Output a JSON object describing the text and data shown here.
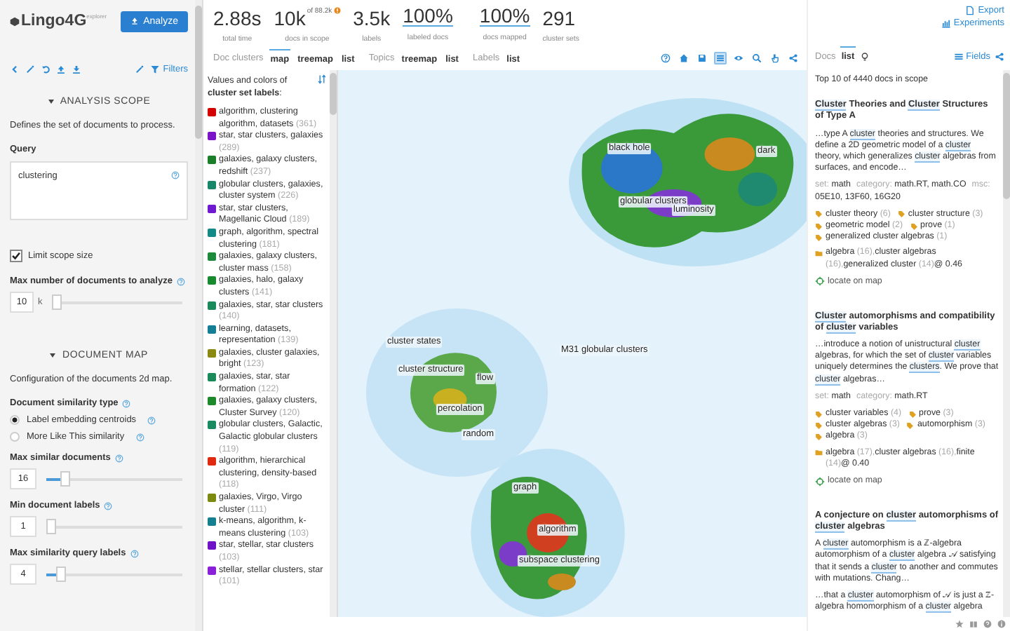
{
  "app": {
    "logo": "Lingo4G",
    "logo_sup": "explorer",
    "analyze_button": "Analyze",
    "filters_link": "Filters"
  },
  "analysis_scope": {
    "title": "ANALYSIS SCOPE",
    "expanded": true,
    "description": "Defines the set of documents to process.",
    "query_label": "Query",
    "query": "clustering",
    "limit_scope": {
      "label": "Limit scope size",
      "checked": true
    },
    "max_docs": {
      "label": "Max number of documents to analyze",
      "value": "10",
      "unit": "k",
      "level": 0.0
    }
  },
  "document_map": {
    "title": "DOCUMENT MAP",
    "expanded": true,
    "description": "Configuration of the documents 2d map.",
    "similarity_label": "Document similarity type",
    "similarity_options": [
      {
        "label": "Label embedding centroids",
        "selected": true
      },
      {
        "label": "More Like This similarity",
        "selected": false
      }
    ],
    "sliders": [
      {
        "label": "Max similar documents",
        "value": "16",
        "level": 0.1
      },
      {
        "label": "Min document labels",
        "value": "1",
        "level": 0.0
      },
      {
        "label": "Max similarity query labels",
        "value": "4",
        "level": 0.07
      }
    ]
  },
  "stats": [
    {
      "value": "2.88s",
      "label": "total time",
      "underlined": false
    },
    {
      "value": "10k",
      "of": "of 88.2k",
      "warning": true,
      "label": "docs in scope",
      "underlined": false
    },
    {
      "value": "3.5k",
      "label": "labels",
      "underlined": false
    },
    {
      "value": "100%",
      "label": "labeled docs",
      "underlined": true
    },
    {
      "value": "100%",
      "label": "docs mapped",
      "underlined": true
    },
    {
      "value": "291",
      "label": "cluster sets",
      "underlined": false
    }
  ],
  "view_tabs": [
    {
      "group": "Doc clusters",
      "tabs": [
        {
          "label": "map",
          "selected": true
        },
        {
          "label": "treemap",
          "selected": false
        },
        {
          "label": "list",
          "selected": false
        }
      ]
    },
    {
      "group": "Topics",
      "tabs": [
        {
          "label": "treemap",
          "selected": false
        },
        {
          "label": "list",
          "selected": false
        }
      ]
    },
    {
      "group": "Labels",
      "tabs": [
        {
          "label": "list",
          "selected": false
        }
      ]
    }
  ],
  "map_tools": [
    {
      "kind": "help",
      "selected": false
    },
    {
      "kind": "home",
      "selected": false
    },
    {
      "kind": "save",
      "selected": false
    },
    {
      "kind": "list",
      "selected": true
    },
    {
      "kind": "eye",
      "selected": false
    },
    {
      "kind": "search",
      "selected": false
    },
    {
      "kind": "hand",
      "selected": false
    },
    {
      "kind": "share",
      "selected": false
    }
  ],
  "export_links": [
    "Export",
    "Experiments"
  ],
  "docs_tabs": {
    "group": "Docs",
    "tabs": [
      {
        "label": "list",
        "selected": true
      }
    ],
    "fields_link": "Fields"
  },
  "legend": {
    "title": "Values and colors of **cluster set labels**:",
    "items": [
      {
        "label": "algorithm, clustering algorithm, datasets",
        "count": "(361)",
        "color": "#d40000"
      },
      {
        "label": "star, star clusters, galaxies",
        "count": "(289)",
        "color": "#7a16c8"
      },
      {
        "label": "galaxies, galaxy clusters, redshift",
        "count": "(237)",
        "color": "#1b7f2a"
      },
      {
        "label": "globular clusters, galaxies, cluster system",
        "count": "(226)",
        "color": "#17876a"
      },
      {
        "label": "star, star clusters, Magellanic Cloud",
        "count": "(189)",
        "color": "#6f1ad0"
      },
      {
        "label": "graph, algorithm, spectral clustering",
        "count": "(181)",
        "color": "#138a86"
      },
      {
        "label": "galaxies, galaxy clusters, cluster mass",
        "count": "(158)",
        "color": "#1c8a3a"
      },
      {
        "label": "galaxies, halo, galaxy clusters",
        "count": "(141)",
        "color": "#188a2e"
      },
      {
        "label": "galaxies, star, star clusters",
        "count": "(140)",
        "color": "#1a8a5a"
      },
      {
        "label": "learning, datasets, representation",
        "count": "(139)",
        "color": "#137e94"
      },
      {
        "label": "galaxies, cluster galaxies, bright",
        "count": "(123)",
        "color": "#8a8a10"
      },
      {
        "label": "galaxies, star, star formation",
        "count": "(122)",
        "color": "#1a8a5b"
      },
      {
        "label": "galaxies, galaxy clusters, Cluster Survey",
        "count": "(120)",
        "color": "#1c8a2a"
      },
      {
        "label": "globular clusters, Galactic, Galactic globular clusters",
        "count": "(119)",
        "color": "#1a8a60"
      },
      {
        "label": "algorithm, hierarchical clustering, density-based",
        "count": "(118)",
        "color": "#e02a10"
      },
      {
        "label": "galaxies, Virgo, Virgo cluster",
        "count": "(111)",
        "color": "#7c8a10"
      },
      {
        "label": "k-means, algorithm, k-means clustering",
        "count": "(103)",
        "color": "#14808f"
      },
      {
        "label": "star, stellar, star clusters",
        "count": "(103)",
        "color": "#7012c8"
      },
      {
        "label": "stellar, stellar clusters, star",
        "count": "(101)",
        "color": "#8a20d8"
      }
    ]
  },
  "map_labels": [
    "black hole",
    "dark",
    "globular clusters",
    "luminosity",
    "M31 globular clusters",
    "cluster states",
    "cluster structure",
    "flow",
    "percolation",
    "random",
    "graph",
    "algorithm",
    "subspace clustering"
  ],
  "docs": {
    "summary": "Top 10 of 4440 docs in scope",
    "items": [
      {
        "title": [
          {
            "text": "Cluster",
            "match": true
          },
          {
            "text": " Theories and ",
            "match": false
          },
          {
            "text": "Cluster",
            "match": true
          },
          {
            "text": " Structures of Type A",
            "match": false
          }
        ],
        "snippets": [
          [
            {
              "text": "…type A ",
              "match": false
            },
            {
              "text": "cluster",
              "match": true
            },
            {
              "text": " theories and structures. We define a 2D geometric model of a ",
              "match": false
            },
            {
              "text": "cluster",
              "match": true
            },
            {
              "text": " theory, which generalizes ",
              "match": false
            },
            {
              "text": "cluster",
              "match": true
            },
            {
              "text": " algebras from surfaces, and encode…",
              "match": false
            }
          ]
        ],
        "meta": [
          {
            "key": "set:",
            "value": "math"
          },
          {
            "key": "category:",
            "value": "math.RT, math.CO"
          },
          {
            "key": "msc:",
            "value": "05E10, 13F60, 16G20"
          }
        ],
        "tags": [
          {
            "label": "cluster theory",
            "count": "(6)"
          },
          {
            "label": "cluster structure",
            "count": "(3)"
          },
          {
            "label": "geometric model",
            "count": "(2)"
          },
          {
            "label": "prove",
            "count": "(1)"
          },
          {
            "label": "generalized cluster algebras",
            "count": "(1)"
          }
        ],
        "topics": [
          {
            "label": "algebra",
            "count": "(16),"
          },
          {
            "label": "cluster algebras",
            "count": "(16),"
          },
          {
            "label": "generalized cluster",
            "count": "(14)"
          }
        ],
        "score": "@ 0.46",
        "locate": "locate on map"
      },
      {
        "title": [
          {
            "text": "Cluster",
            "match": true
          },
          {
            "text": " automorphisms and compatibility of ",
            "match": false
          },
          {
            "text": "cluster",
            "match": true
          },
          {
            "text": " variables",
            "match": false
          }
        ],
        "snippets": [
          [
            {
              "text": "…introduce a notion of unistructural ",
              "match": false
            },
            {
              "text": "cluster",
              "match": true
            },
            {
              "text": " algebras, for which the set of ",
              "match": false
            },
            {
              "text": "cluster",
              "match": true
            },
            {
              "text": " variables uniquely determines the ",
              "match": false
            },
            {
              "text": "clusters",
              "match": true
            },
            {
              "text": ". We prove that ",
              "match": false
            },
            {
              "text": "cluster",
              "match": true
            },
            {
              "text": " algebras…",
              "match": false
            }
          ]
        ],
        "meta": [
          {
            "key": "set:",
            "value": "math"
          },
          {
            "key": "category:",
            "value": "math.RT"
          }
        ],
        "tags": [
          {
            "label": "cluster variables",
            "count": "(4)"
          },
          {
            "label": "prove",
            "count": "(3)"
          },
          {
            "label": "cluster algebras",
            "count": "(3)"
          },
          {
            "label": "automorphism",
            "count": "(3)"
          },
          {
            "label": "algebra",
            "count": "(3)"
          }
        ],
        "topics": [
          {
            "label": "algebra",
            "count": "(17),"
          },
          {
            "label": "cluster algebras",
            "count": "(16),"
          },
          {
            "label": "finite",
            "count": "(14)"
          }
        ],
        "score": "@ 0.40",
        "locate": "locate on map"
      },
      {
        "title": [
          {
            "text": "A conjecture on ",
            "match": false
          },
          {
            "text": "cluster",
            "match": true
          },
          {
            "text": " automorphisms of ",
            "match": false
          },
          {
            "text": "cluster",
            "match": true
          },
          {
            "text": " algebras",
            "match": false
          }
        ],
        "snippets": [
          [
            {
              "text": "A ",
              "match": false
            },
            {
              "text": "cluster",
              "match": true
            },
            {
              "text": " automorphism is a ℤ-algebra automorphism of a ",
              "match": false
            },
            {
              "text": "cluster",
              "match": true
            },
            {
              "text": " algebra 𝒜 satisfying that it sends a ",
              "match": false
            },
            {
              "text": "cluster",
              "match": true
            },
            {
              "text": " to another and commutes with mutations. Chang…",
              "match": false
            }
          ],
          [
            {
              "text": "…that a ",
              "match": false
            },
            {
              "text": "cluster",
              "match": true
            },
            {
              "text": " automorphism of 𝒜 is just a ℤ-algebra homomorphism of a ",
              "match": false
            },
            {
              "text": "cluster",
              "match": true
            },
            {
              "text": " algebra",
              "match": false
            }
          ]
        ]
      }
    ]
  }
}
